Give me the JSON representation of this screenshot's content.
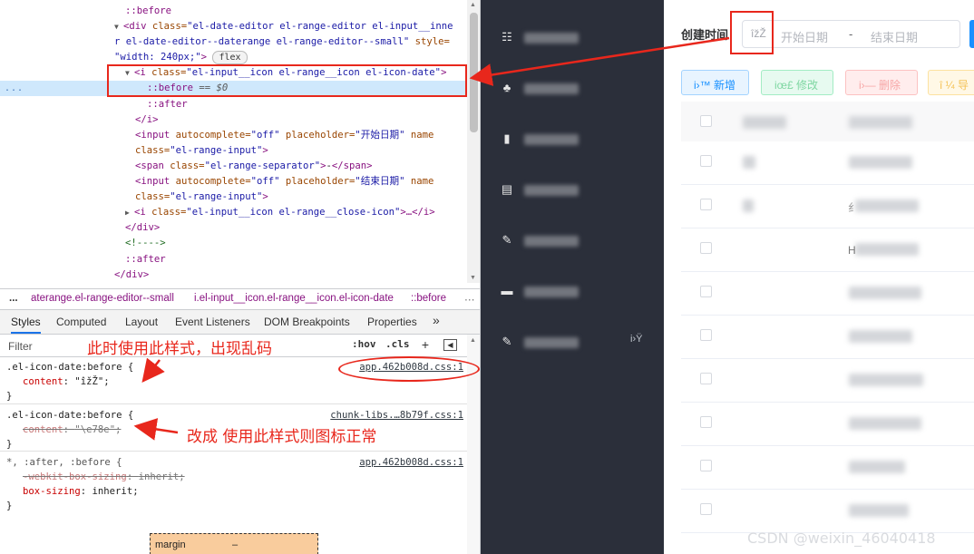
{
  "elements_panel": {
    "lines": [
      {
        "a": "::before"
      },
      {
        "tag": "<div ",
        "attrs": "class=",
        "val": "\"el-date-editor el-range-editor el-input__inne"
      },
      {
        "val": "r el-date-editor--daterange el-range-editor--small\"",
        "attrs": " style="
      },
      {
        "val": "\"width: 240px;\"",
        "tag": ">",
        "badge": "flex"
      },
      {
        "tag": "<i ",
        "attrs": "class=",
        "val": "\"el-input__icon el-range__icon el-icon-date\"",
        "close": ">"
      },
      {
        "a": "::before",
        "b": " == $0",
        "dots": "..."
      },
      {
        "a": "::after"
      },
      {
        "tag": "</i>"
      },
      {
        "tag": "<input ",
        "attrs": "autocomplete=",
        "val": "\"off\"",
        "attrs2": " placeholder=",
        "val2": "\"开始日期\"",
        "attrs3": " name"
      },
      {
        "attrs": "class=",
        "val": "\"el-range-input\"",
        "tag": ">"
      },
      {
        "tag": "<span ",
        "attrs": "class=",
        "val": "\"el-range-separator\"",
        "tag2": ">",
        "text": "-",
        "tag3": "</span>"
      },
      {
        "tag": "<input ",
        "attrs": "autocomplete=",
        "val": "\"off\"",
        "attrs2": " placeholder=",
        "val2": "\"结束日期\"",
        "attrs3": " name"
      },
      {
        "attrs": "class=",
        "val": "\"el-range-input\"",
        "tag": ">"
      },
      {
        "tag": "<i ",
        "attrs": "class=",
        "val": "\"el-input__icon el-range__close-icon\"",
        "tag2": ">…</i>"
      },
      {
        "tag": "</div>"
      },
      {
        "comment": "<!---->"
      },
      {
        "a": "::after"
      },
      {
        "tag": "</div>"
      }
    ]
  },
  "breadcrumbs": {
    "more": "...",
    "item1": "aterange.el-range-editor--small",
    "item2": "i.el-input__icon.el-range__icon.el-icon-date",
    "item3": "::before"
  },
  "tabs": {
    "styles": "Styles",
    "computed": "Computed",
    "layout": "Layout",
    "event_listeners": "Event Listeners",
    "dom_breakpoints": "DOM Breakpoints",
    "properties": "Properties",
    "more": "»"
  },
  "filter": {
    "placeholder": "Filter",
    "hov": ":hov",
    "cls": ".cls",
    "plus": "+"
  },
  "rules": [
    {
      "selector": ".el-icon-date:before {",
      "source": "app.462b008d.css:1",
      "prop": "content",
      "value": "\"îžŽ\";"
    },
    {
      "selector": ".el-icon-date:before {",
      "source": "chunk-libs.…8b79f.css:1",
      "prop": "content",
      "value": "\"\\e78e\";"
    },
    {
      "selector": "*, :after, :before {",
      "source": "app.462b008d.css:1",
      "prop": "-webkit-box-sizing",
      "value": "inherit;",
      "prop2": "box-sizing",
      "value2": "inherit;"
    }
  ],
  "brace_close": "}",
  "box_model": {
    "label": "margin",
    "value": "–"
  },
  "annotations": {
    "note1": "此时使用此样式，出现乱码",
    "note2": "改成 使用此样式则图标正常",
    "accent": "#e8271c"
  },
  "sidebar": {
    "extra": "i›Ÿ"
  },
  "main": {
    "date_label": "创建时间",
    "range_icon": "îžŽ",
    "start_placeholder": "开始日期",
    "separator": "-",
    "end_placeholder": "结束日期",
    "buttons": {
      "add": "i›™ 新增",
      "edit": "iœ£ 修改",
      "delete": "i›— 删除",
      "export": "î ¼ 导"
    },
    "row_fragments": [
      "",
      "",
      "",
      "纟",
      "H",
      "",
      "",
      "",
      "",
      "",
      ""
    ]
  },
  "watermark": "CSDN @weixin_46040418"
}
